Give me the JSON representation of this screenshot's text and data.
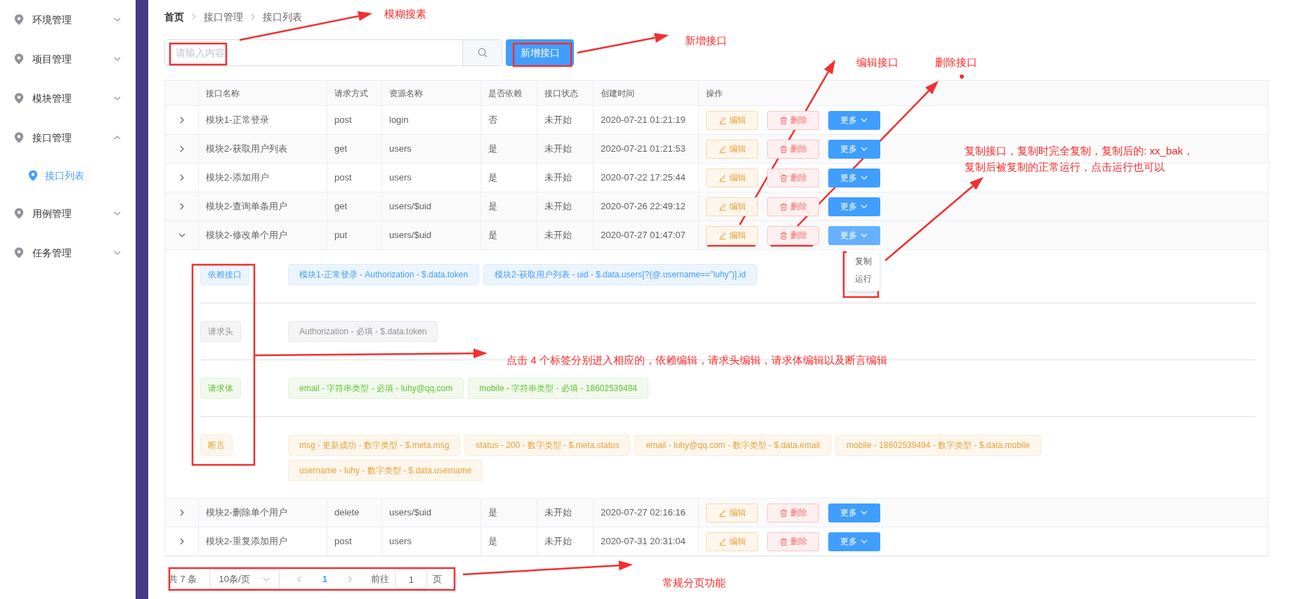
{
  "sidebar": {
    "items": [
      {
        "label": "环境管理",
        "expanded": false,
        "selected": false
      },
      {
        "label": "项目管理",
        "expanded": false,
        "selected": false
      },
      {
        "label": "模块管理",
        "expanded": false,
        "selected": false
      },
      {
        "label": "接口管理",
        "expanded": true,
        "selected": false,
        "children": [
          {
            "label": "接口列表",
            "selected": true
          }
        ]
      },
      {
        "label": "用例管理",
        "expanded": false,
        "selected": false
      },
      {
        "label": "任务管理",
        "expanded": false,
        "selected": false
      }
    ]
  },
  "breadcrumb": [
    "首页",
    "接口管理",
    "接口列表"
  ],
  "search": {
    "placeholder": "请输入内容"
  },
  "add_button": "新增接口",
  "table": {
    "columns": [
      "接口名称",
      "请求方式",
      "资源名称",
      "是否依赖",
      "接口状态",
      "创建时间",
      "操作"
    ],
    "rows": [
      {
        "name": "模块1-正常登录",
        "method": "post",
        "resource": "login",
        "depends": "否",
        "status": "未开始",
        "created": "2020-07-21 01:21:19",
        "expanded": false,
        "actions": [
          "编辑",
          "删除",
          "更多"
        ]
      },
      {
        "name": "模块2-获取用户列表",
        "method": "get",
        "resource": "users",
        "depends": "是",
        "status": "未开始",
        "created": "2020-07-21 01:21:53",
        "expanded": false,
        "actions": [
          "编辑",
          "删除",
          "更多"
        ]
      },
      {
        "name": "模块2-添加用户",
        "method": "post",
        "resource": "users",
        "depends": "是",
        "status": "未开始",
        "created": "2020-07-22 17:25:44",
        "expanded": false,
        "actions": [
          "编辑",
          "删除",
          "更多"
        ]
      },
      {
        "name": "模块2-查询单条用户",
        "method": "get",
        "resource": "users/$uid",
        "depends": "是",
        "status": "未开始",
        "created": "2020-07-26 22:49:12",
        "expanded": false,
        "actions": [
          "编辑",
          "删除",
          "更多"
        ]
      },
      {
        "name": "模块2-修改单个用户",
        "method": "put",
        "resource": "users/$uid",
        "depends": "是",
        "status": "未开始",
        "created": "2020-07-27 01:47:07",
        "expanded": true,
        "actions": [
          "编辑",
          "删除",
          "更多"
        ],
        "more_menu": [
          "复制",
          "运行"
        ],
        "details": [
          {
            "kind": "dependency",
            "label": "依赖接口",
            "tags": [
              "模块1-正常登录 - Authorization - $.data.token",
              "模块2-获取用户列表 - uid - $.data.users[?(@.username==\"luhy\")].id"
            ]
          },
          {
            "kind": "header",
            "label": "请求头",
            "tags": [
              "Authorization - 必填 - $.data.token"
            ]
          },
          {
            "kind": "body",
            "label": "请求体",
            "tags": [
              "email - 字符串类型 - 必填 - luhy@qq.com",
              "mobile - 字符串类型 - 必填 - 18602539494"
            ]
          },
          {
            "kind": "assert",
            "label": "断言",
            "tags": [
              "msg - 更新成功 - 数字类型 - $.meta.msg",
              "status - 200 - 数字类型 - $.meta.status",
              "email - luhy@qq.com - 数字类型 - $.data.email",
              "mobile - 18602539494 - 数字类型 - $.data.mobile",
              "username - luhy - 数字类型 - $.data.username"
            ]
          }
        ]
      },
      {
        "name": "模块2-删除单个用户",
        "method": "delete",
        "resource": "users/$uid",
        "depends": "是",
        "status": "未开始",
        "created": "2020-07-27 02:16:16",
        "expanded": false,
        "actions": [
          "编辑",
          "删除",
          "更多"
        ]
      },
      {
        "name": "模块2-重复添加用户",
        "method": "post",
        "resource": "users",
        "depends": "是",
        "status": "未开始",
        "created": "2020-07-31 20:31:04",
        "expanded": false,
        "actions": [
          "编辑",
          "删除",
          "更多"
        ]
      }
    ]
  },
  "pagination": {
    "total": "共 7 条",
    "page_size": "10条/页",
    "current_page": "1",
    "goto_label": "前往",
    "goto_value": "1",
    "goto_suffix": "页"
  },
  "annotations": [
    "模糊搜素",
    "新增接口",
    "编辑接口",
    "删除接口",
    "复制接口，复制时完全复制，复制后的: xx_bak，",
    "复制后被复制的正常运行，点击运行也可以",
    "点击 4 个标签分别进入相应的，依赖编辑，请求头编辑，请求体编辑以及断言编辑",
    "常规分页功能"
  ]
}
